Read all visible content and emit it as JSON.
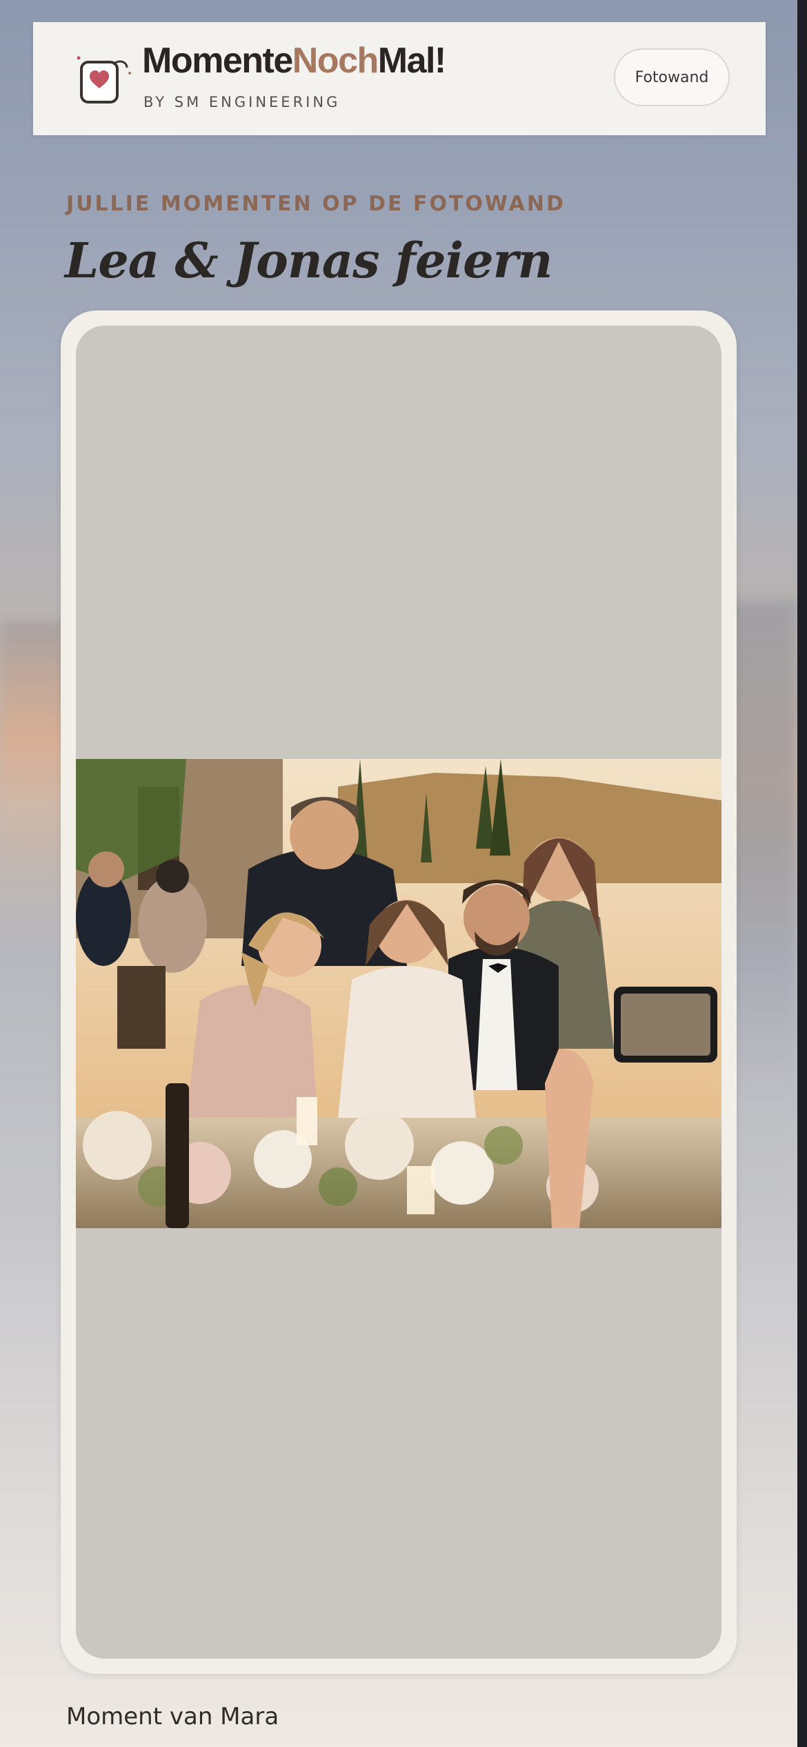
{
  "header": {
    "brand_part1": "Momente",
    "brand_part2": "Noch",
    "brand_part3": "Mal!",
    "byline": "BY SM ENGINEERING",
    "nav_button_label": "Fotowand",
    "logo_icon": "heart-frame-icon"
  },
  "hero": {
    "eyebrow": "JULLIE MOMENTEN OP DE FOTOWAND",
    "title": "Lea & Jonas feiern"
  },
  "card": {
    "photo": "group-photo-wedding-celebration",
    "caption": "Moment van Mara"
  },
  "colors": {
    "accent": "#a5785f",
    "eyebrow": "#8b6754",
    "card_bg": "#f2efe9",
    "placeholder": "#c9c7c0"
  }
}
